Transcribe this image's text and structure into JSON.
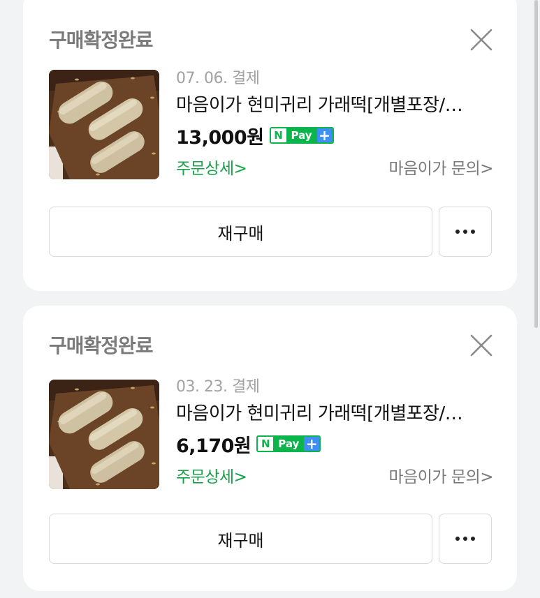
{
  "orders": [
    {
      "status": "구매확정완료",
      "date": "07. 06. 결제",
      "product_name": "마음이가 현미귀리 가래떡[개별포장/…",
      "price": "13,000원",
      "npay": {
        "n": "N",
        "pay": "Pay",
        "plus": "+"
      },
      "detail_link": "주문상세>",
      "seller_link": "마음이가 문의>",
      "rebuy_label": "재구매",
      "close_icon": "close-icon",
      "more_icon": "more-horizontal-icon"
    },
    {
      "status": "구매확정완료",
      "date": "03. 23. 결제",
      "product_name": "마음이가 현미귀리 가래떡[개별포장/…",
      "price": "6,170원",
      "npay": {
        "n": "N",
        "pay": "Pay",
        "plus": "+"
      },
      "detail_link": "주문상세>",
      "seller_link": "마음이가 문의>",
      "rebuy_label": "재구매",
      "close_icon": "close-icon",
      "more_icon": "more-horizontal-icon"
    }
  ],
  "colors": {
    "background": "#f2f3f5",
    "card": "#ffffff",
    "status_text": "#7a7a7a",
    "naver_green": "#0bb54c",
    "detail_green": "#17a34a",
    "plus_blue": "#3f8ef2"
  }
}
